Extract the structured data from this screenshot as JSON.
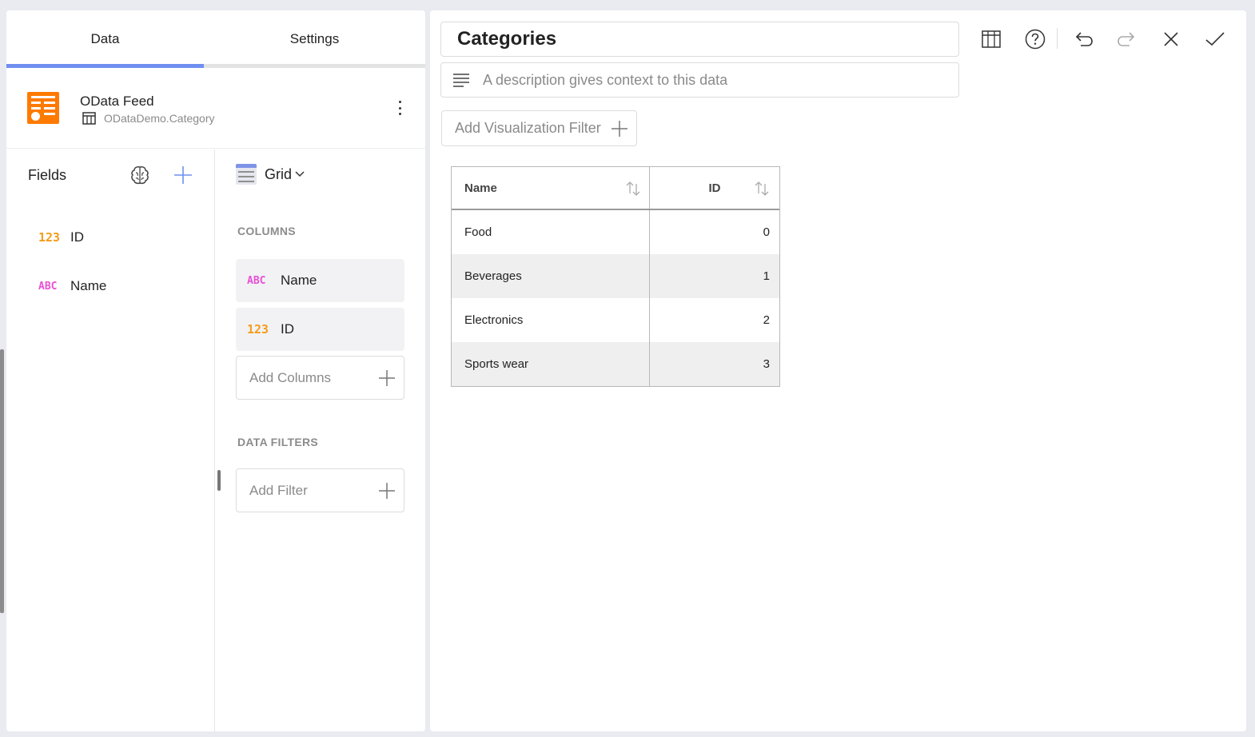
{
  "tabs": [
    {
      "label": "Data",
      "active": true
    },
    {
      "label": "Settings",
      "active": false
    }
  ],
  "source": {
    "title": "OData Feed",
    "subtitle": "ODataDemo.Category",
    "icon": "odata-feed-icon",
    "icon_color": "#ff7a00"
  },
  "fields": {
    "title": "Fields",
    "items": [
      {
        "type": "123",
        "label": "ID"
      },
      {
        "type": "ABC",
        "label": "Name"
      }
    ]
  },
  "config": {
    "viz_type": "Grid",
    "columns_label": "COLUMNS",
    "columns": [
      {
        "type": "ABC",
        "label": "Name"
      },
      {
        "type": "123",
        "label": "ID"
      }
    ],
    "add_columns": "Add Columns",
    "data_filters_label": "DATA FILTERS",
    "add_filter": "Add Filter"
  },
  "editor": {
    "title": "Categories",
    "description_placeholder": "A description gives context to this data",
    "add_viz_filter": "Add Visualization Filter"
  },
  "grid": {
    "headers": [
      "Name",
      "ID"
    ],
    "rows": [
      {
        "name": "Food",
        "id": "0"
      },
      {
        "name": "Beverages",
        "id": "1"
      },
      {
        "name": "Electronics",
        "id": "2"
      },
      {
        "name": "Sports wear",
        "id": "3"
      }
    ]
  },
  "colors": {
    "accent": "#6f8ff0",
    "number_type": "#f59b1a",
    "text_type": "#e84fd6"
  }
}
